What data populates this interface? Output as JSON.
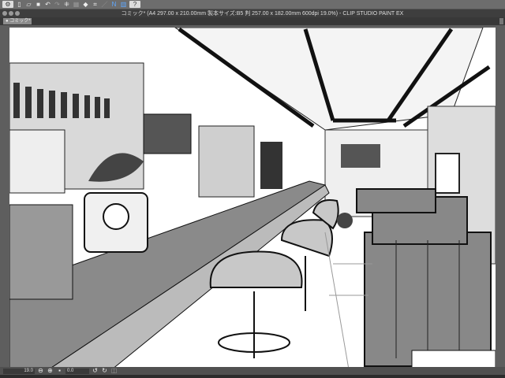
{
  "window": {
    "title": "コミック* (A4 297.00 x 210.00mm 製本サイズ:B5 判 257.00 x 182.00mm 600dpi 19.0%) - CLIP STUDIO PAINT EX"
  },
  "tabs": [
    {
      "label": "● コミック*"
    }
  ],
  "toolbar": {
    "icons": [
      "clip-studio-menu-icon",
      "new-icon",
      "open-icon",
      "save-icon",
      "undo-icon",
      "redo-icon",
      "transform-icon",
      "clear-icon",
      "fill-icon",
      "fit-icon",
      "snap-ruler-icon",
      "snap-special-ruler-icon",
      "snap-grid-icon",
      "help-icon"
    ]
  },
  "status": {
    "zoom": "19.0",
    "angle": "0.0"
  }
}
